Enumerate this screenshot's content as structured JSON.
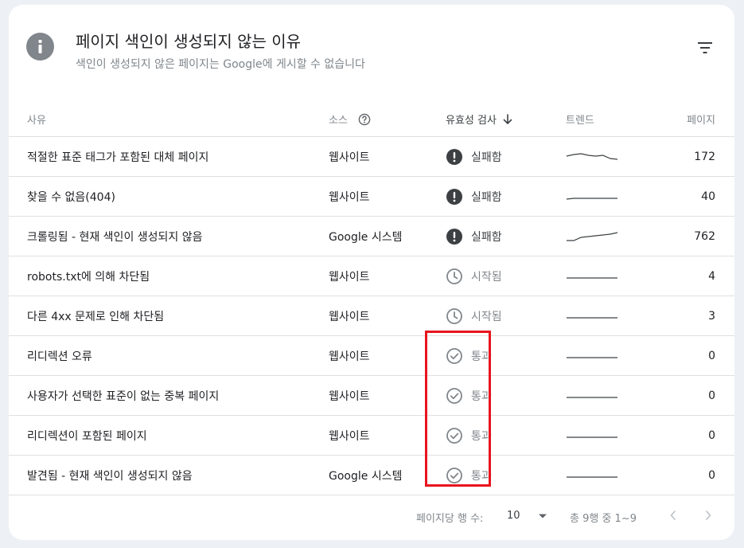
{
  "header": {
    "title": "페이지 색인이 생성되지 않는 이유",
    "subtitle": "색인이 생성되지 않은 페이지는 Google에 게시할 수 없습니다"
  },
  "columns": {
    "reason": "사유",
    "source": "소스",
    "validation": "유효성 검사",
    "trend": "트렌드",
    "pages": "페이지"
  },
  "rows": [
    {
      "reason": "적절한 표준 태그가 포함된 대체 페이지",
      "source": "웹사이트",
      "status": "실패함",
      "status_type": "fail",
      "trend": [
        0.45,
        0.35,
        0.3,
        0.4,
        0.45,
        0.4,
        0.6,
        0.65
      ],
      "pages": "172"
    },
    {
      "reason": "찾을 수 없음(404)",
      "source": "웹사이트",
      "status": "실패함",
      "status_type": "fail",
      "trend": [
        0.65,
        0.6,
        0.6,
        0.6,
        0.6,
        0.6,
        0.6,
        0.6
      ],
      "pages": "40"
    },
    {
      "reason": "크롤링됨 - 현재 색인이 생성되지 않음",
      "source": "Google 시스템",
      "status": "실패함",
      "status_type": "fail",
      "trend": [
        0.75,
        0.75,
        0.55,
        0.5,
        0.45,
        0.4,
        0.35,
        0.25
      ],
      "pages": "762"
    },
    {
      "reason": "robots.txt에 의해 차단됨",
      "source": "웹사이트",
      "status": "시작됨",
      "status_type": "started",
      "trend": [
        0.6,
        0.6,
        0.6,
        0.6,
        0.6,
        0.6,
        0.6,
        0.6
      ],
      "pages": "4"
    },
    {
      "reason": "다른 4xx 문제로 인해 차단됨",
      "source": "웹사이트",
      "status": "시작됨",
      "status_type": "started",
      "trend": [
        0.6,
        0.6,
        0.6,
        0.6,
        0.6,
        0.6,
        0.6,
        0.6
      ],
      "pages": "3"
    },
    {
      "reason": "리디렉션 오류",
      "source": "웹사이트",
      "status": "통과",
      "status_type": "passed",
      "trend": [
        0.6,
        0.6,
        0.6,
        0.6,
        0.6,
        0.6,
        0.6,
        0.6
      ],
      "pages": "0"
    },
    {
      "reason": "사용자가 선택한 표준이 없는 중복 페이지",
      "source": "웹사이트",
      "status": "통과",
      "status_type": "passed",
      "trend": [
        0.6,
        0.6,
        0.6,
        0.6,
        0.6,
        0.6,
        0.6,
        0.6
      ],
      "pages": "0"
    },
    {
      "reason": "리디렉션이 포함된 페이지",
      "source": "웹사이트",
      "status": "통과",
      "status_type": "passed",
      "trend": [
        0.6,
        0.6,
        0.6,
        0.6,
        0.6,
        0.6,
        0.6,
        0.6
      ],
      "pages": "0"
    },
    {
      "reason": "발견됨 - 현재 색인이 생성되지 않음",
      "source": "Google 시스템",
      "status": "통과",
      "status_type": "passed",
      "trend": [
        0.6,
        0.6,
        0.6,
        0.6,
        0.6,
        0.6,
        0.6,
        0.6
      ],
      "pages": "0"
    }
  ],
  "footer": {
    "rows_per_page_label": "페이지당 행 수:",
    "rows_per_page_value": "10",
    "range": "총 9행 중 1~9"
  },
  "colors": {
    "highlight": "#e8141d",
    "fail_icon": "#3c4043",
    "muted": "#80868b"
  }
}
